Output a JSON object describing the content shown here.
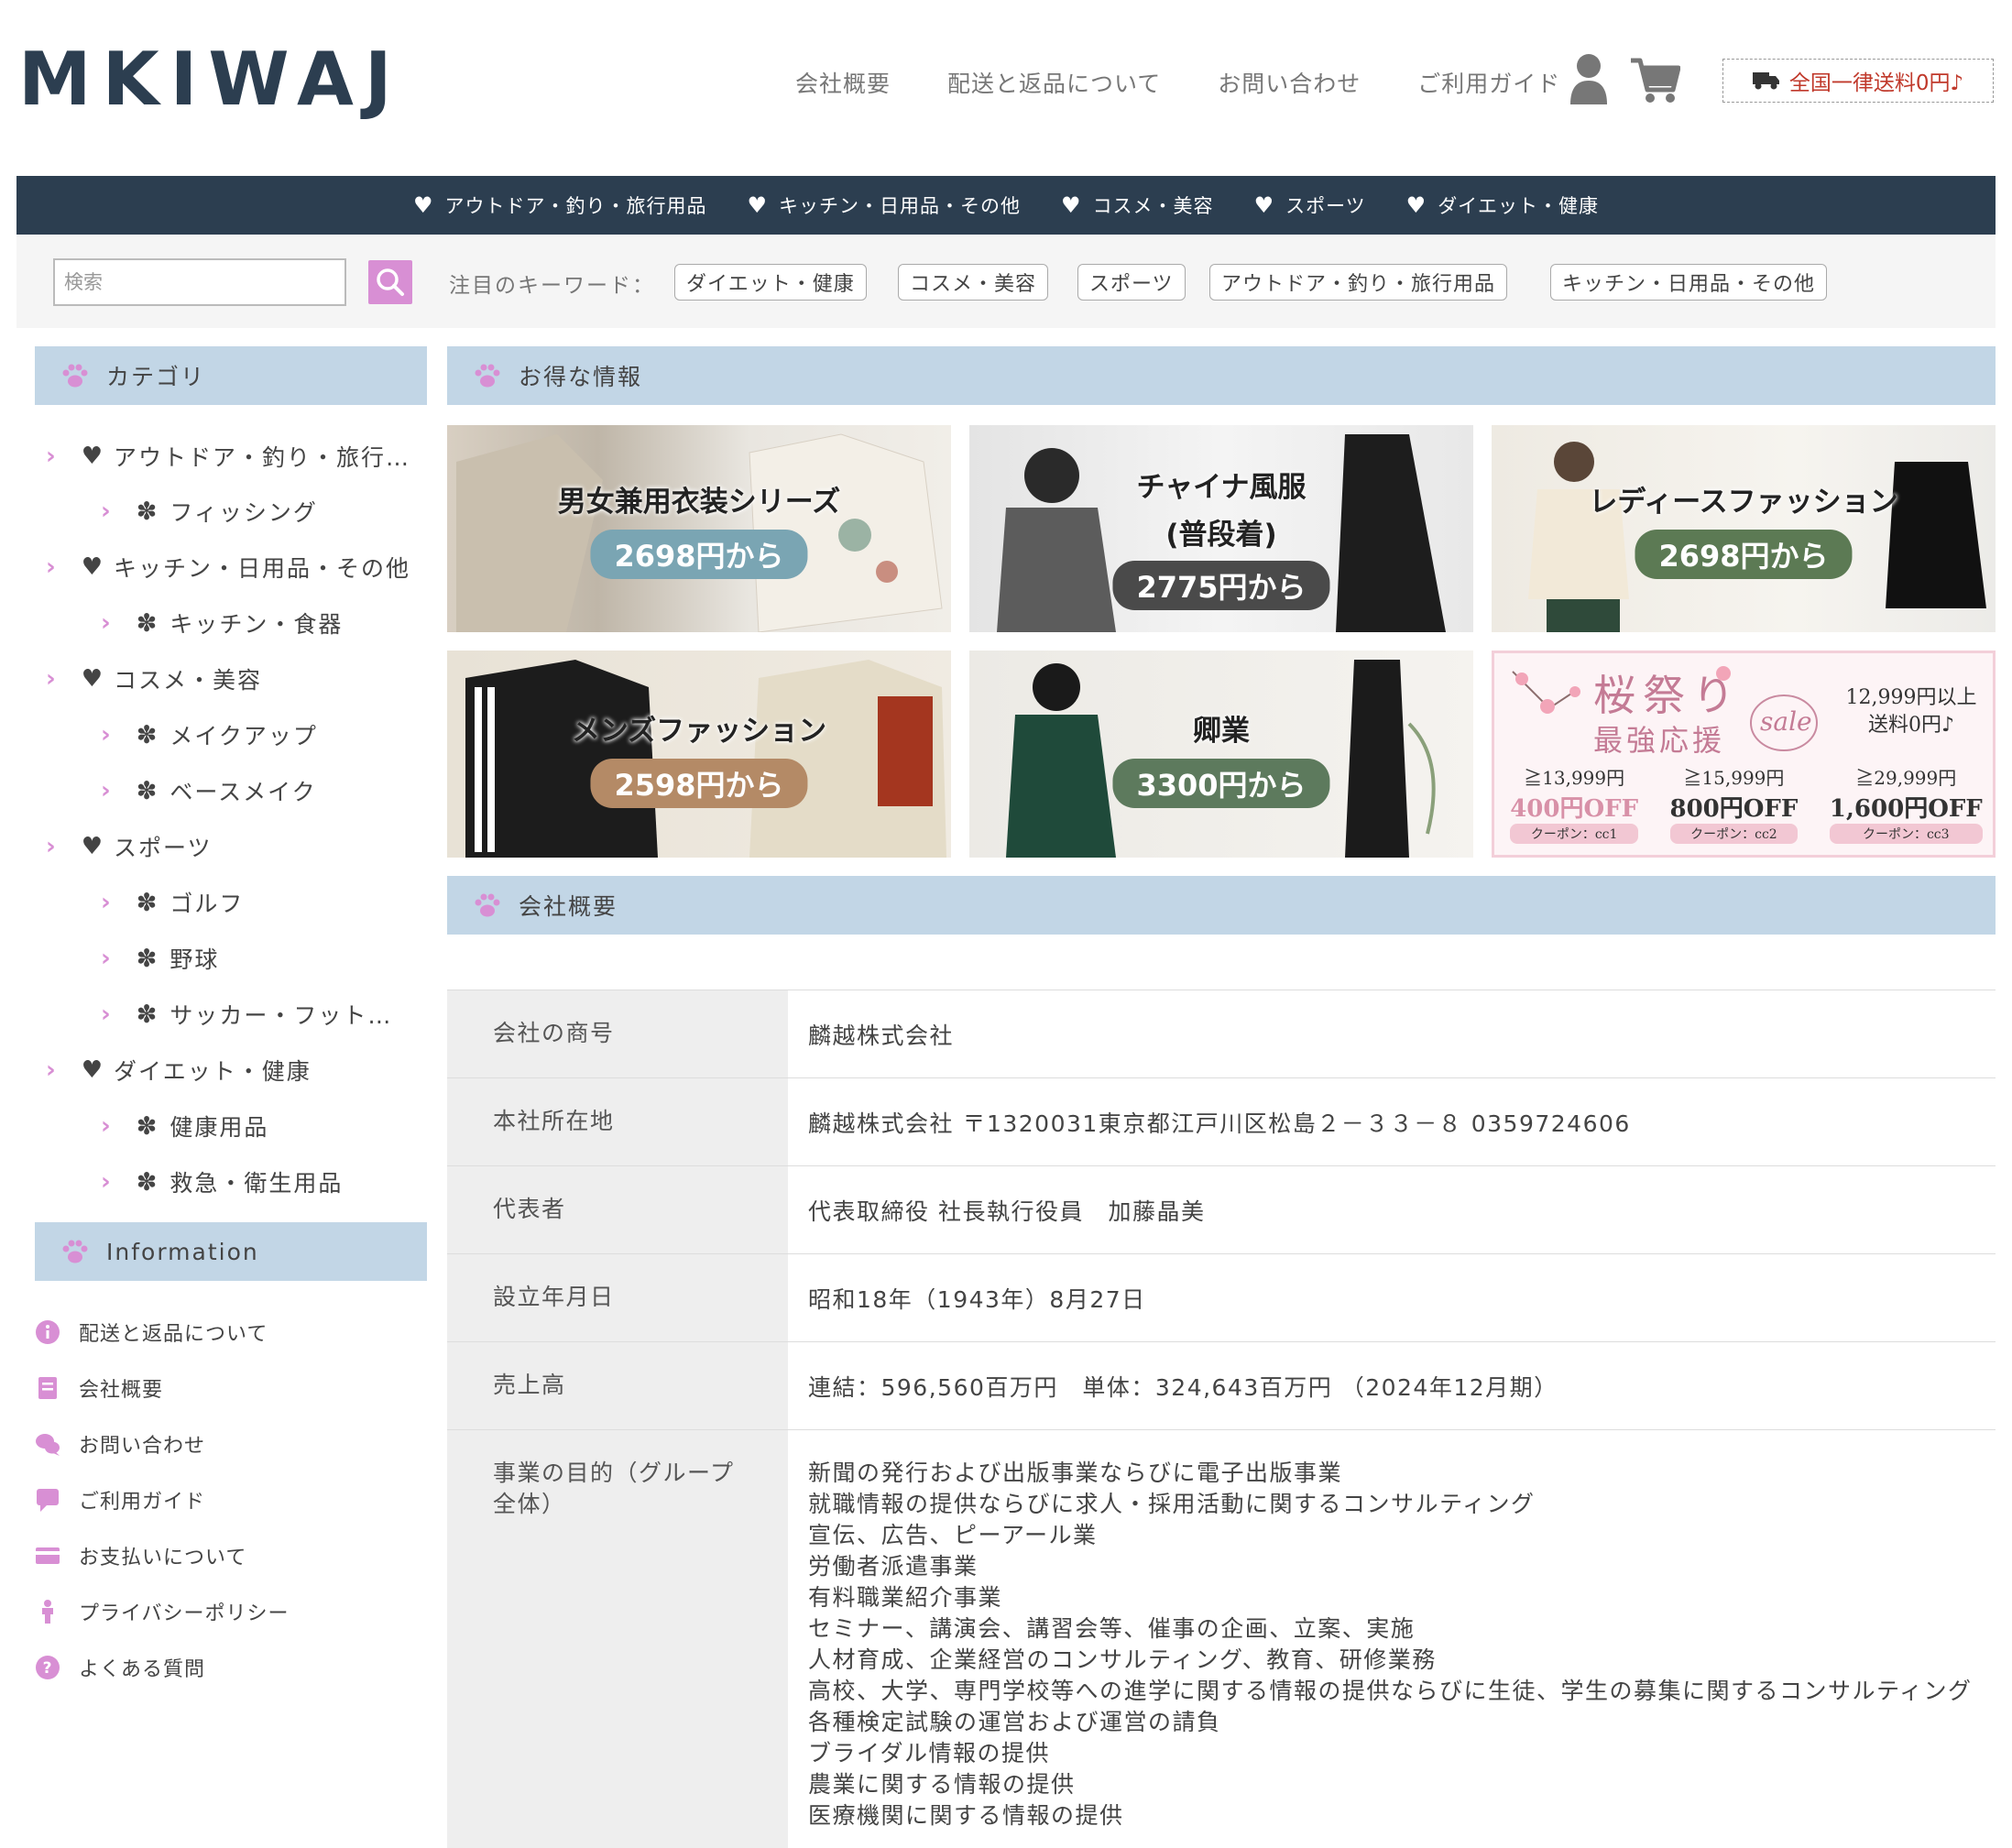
{
  "header": {
    "logo": "MKIWAJ",
    "nav": [
      "会社概要",
      "配送と返品について",
      "お問い合わせ",
      "ご利用ガイド"
    ],
    "shipping_badge": "全国一律送料0円♪"
  },
  "category_bar": [
    "アウトドア・釣り・旅行用品",
    "キッチン・日用品・その他",
    "コスメ・美容",
    "スポーツ",
    "ダイエット・健康"
  ],
  "search": {
    "placeholder": "検索",
    "keyword_label": "注目のキーワード：",
    "keywords": [
      "ダイエット・健康",
      "コスメ・美容",
      "スポーツ",
      "アウトドア・釣り・旅行用品",
      "キッチン・日用品・その他"
    ]
  },
  "sidebar": {
    "category_title": "カテゴリ",
    "categories": [
      {
        "label": "アウトドア・釣り・旅行…",
        "children": [
          "フィッシング"
        ]
      },
      {
        "label": "キッチン・日用品・その他",
        "children": [
          "キッチン・食器"
        ]
      },
      {
        "label": "コスメ・美容",
        "children": [
          "メイクアップ",
          "ベースメイク"
        ]
      },
      {
        "label": "スポーツ",
        "children": [
          "ゴルフ",
          "野球",
          "サッカー・フット…"
        ]
      },
      {
        "label": "ダイエット・健康",
        "children": [
          "健康用品",
          "救急・衛生用品"
        ]
      }
    ],
    "info_title": "Information",
    "info_items": [
      "配送と返品について",
      "会社概要",
      "お問い合わせ",
      "ご利用ガイド",
      "お支払いについて",
      "プライバシーポリシー",
      "よくある質問"
    ]
  },
  "deals": {
    "title": "お得な情報",
    "banners": [
      {
        "title": "男女兼用衣装シリーズ",
        "price": "2698円から"
      },
      {
        "title": "チャイナ風服",
        "subtitle": "(普段着)",
        "price": "2775円から"
      },
      {
        "title": "レディースファッション",
        "price": "2698円から"
      },
      {
        "title": "メンズファッション",
        "price": "2598円から"
      },
      {
        "title": "卿業",
        "price": "3300円から"
      }
    ],
    "sale_banner": {
      "title": "桜祭り",
      "subtitle": "最強応援",
      "sale": "sale",
      "shipping_line1": "12,999円以上",
      "shipping_line2": "送料0円♪",
      "tiers": [
        {
          "threshold": "≧13,999円",
          "off": "400円OFF",
          "coupon": "クーポン：cc1"
        },
        {
          "threshold": "≧15,999円",
          "off": "800円OFF",
          "coupon": "クーポン：cc2"
        },
        {
          "threshold": "≧29,999円",
          "off": "1,600円OFF",
          "coupon": "クーポン：cc3"
        }
      ]
    }
  },
  "company": {
    "title": "会社概要",
    "rows": [
      {
        "label": "会社の商号",
        "value": "麟越株式会社"
      },
      {
        "label": "本社所在地",
        "value": "麟越株式会社 〒1320031東京都江戸川区松島２－３３－８ 0359724606"
      },
      {
        "label": "代表者",
        "value": "代表取締役 社長執行役員　加藤晶美"
      },
      {
        "label": "設立年月日",
        "value": "昭和18年（1943年）8月27日"
      },
      {
        "label": "売上高",
        "value": "連結：596,560百万円　単体：324,643百万円 （2024年12月期）"
      }
    ],
    "business_label": "事業の目的（グループ全体）",
    "business_items": [
      "新聞の発行および出版事業ならびに電子出版事業",
      "就職情報の提供ならびに求人・採用活動に関するコンサルティング",
      "宣伝、広告、ピーアール業",
      "労働者派遣事業",
      "有料職業紹介事業",
      "セミナー、講演会、講習会等、催事の企画、立案、実施",
      "人材育成、企業経営のコンサルティング、教育、研修業務",
      "高校、大学、専門学校等への進学に関する情報の提供ならびに生徒、学生の募集に関するコンサルティング",
      "各種検定試験の運営および運営の請負",
      "ブライダル情報の提供",
      "農業に関する情報の提供",
      "医療機関に関する情報の提供"
    ]
  }
}
